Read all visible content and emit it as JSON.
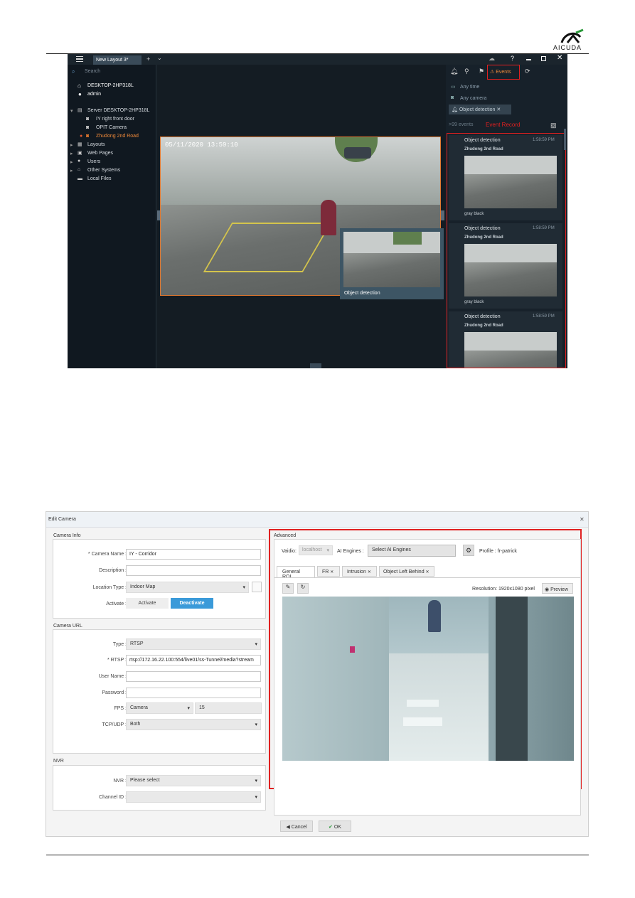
{
  "logo": {
    "text": "AICUDA"
  },
  "app": {
    "tab": "New Layout 3*",
    "search": "Search",
    "tree": {
      "host": "DESKTOP-2HP318L",
      "user": "admin",
      "server": "Server DESKTOP-2HP318L",
      "cameras": [
        "IY right front door",
        "OPIT Camera",
        "Zhudong 2nd Road"
      ],
      "nodes": [
        "Layouts",
        "Web Pages",
        "Users",
        "Other Systems",
        "Local Files"
      ]
    },
    "timestamp": "05/11/2020 13:59:10",
    "popup_label": "Object detection",
    "panel": {
      "events_tab": "Events",
      "filters": [
        "Any time",
        "Any camera"
      ],
      "chip": "Object detection",
      "count": ">99 events",
      "event_record_label": "Event Record",
      "events": [
        {
          "title": "Object detection",
          "time": "1:58:59 PM",
          "camera": "Zhudong 2nd Road",
          "caption": "gray black"
        },
        {
          "title": "Object detection",
          "time": "1:58:59 PM",
          "camera": "Zhudong 2nd Road",
          "caption": "gray black"
        },
        {
          "title": "Object detection",
          "time": "1:58:59 PM",
          "camera": "Zhudong 2nd Road",
          "caption": ""
        }
      ]
    }
  },
  "dialog": {
    "title": "Edit Camera",
    "camera_info": "Camera Info",
    "fields": {
      "camera_name_label": "* Camera Name :",
      "camera_name": "IY - Corridor",
      "description_label": "Description :",
      "location_label": "Location Type :",
      "location": "Indoor Map",
      "activate_label": "Activate :",
      "activate": "Activate",
      "deactivate": "Deactivate"
    },
    "camera_url": "Camera URL",
    "url": {
      "type_label": "Type :",
      "type": "RTSP",
      "rtsp_label": "* RTSP :",
      "rtsp": "rtsp://172.16.22.100:554/live01/ss-Tunnel/media?stream",
      "user_label": "User Name :",
      "password_label": "Password :",
      "fps_label": "FPS :",
      "fps_mode": "Camera",
      "fps": "15",
      "tcp_label": "TCP/UDP :",
      "tcp": "Both"
    },
    "nvr": {
      "section": "NVR",
      "nvr_label": "NVR :",
      "nvr": "Please select",
      "channel_label": "Channel ID :"
    },
    "advanced": {
      "section": "Advanced",
      "vaidio_label": "Vaidio:",
      "vaidio": "localhost",
      "engines_label": "AI Engines :",
      "engines": "Select AI Engines",
      "profile": "Profile : fr-patrick",
      "tabs": [
        "General ROI",
        "FR",
        "Intrusion",
        "Object Left Behind"
      ],
      "resolution": "Resolution: 1920x1080 pixel",
      "preview": "Preview"
    },
    "cancel": "Cancel",
    "ok": "OK"
  }
}
